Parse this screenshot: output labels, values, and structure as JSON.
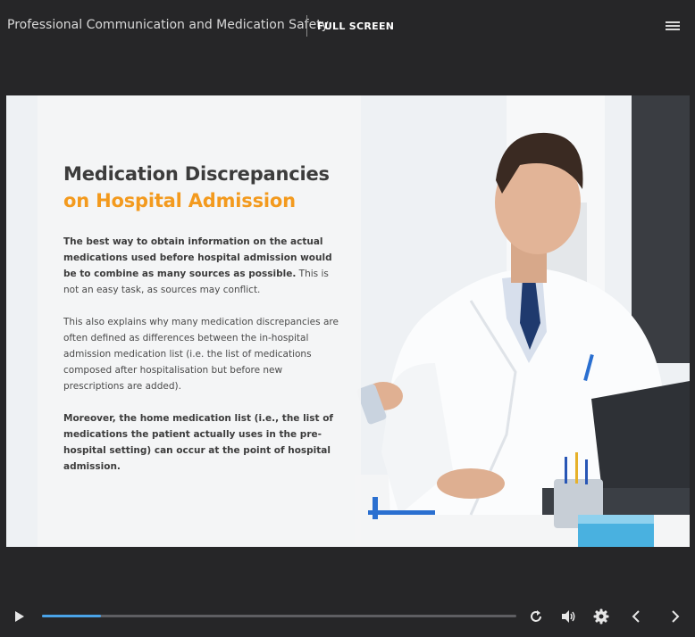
{
  "header": {
    "course_title": "Professional Communication and Medication Safety",
    "fullscreen_label": "FULL SCREEN"
  },
  "slide": {
    "heading_line1": "Medication Discrepancies",
    "heading_line2": "on Hospital Admission",
    "para1_bold": "The best way to obtain information on the actual medications used before hospital admission would be to combine as many sources as possible.",
    "para1_rest": " This is not an easy task, as sources may conflict.",
    "para2": "This also explains why many medication discrepancies are often defined as differences between the in-hospital admission medication list (i.e. the list of medications composed after hospitalisation but before new prescriptions are added).",
    "para3": "Moreover, the home medication list (i.e., the list of medications the patient actually uses in the pre-hospital setting) can occur at the point of hospital admission."
  },
  "player": {
    "progress": 0.125
  },
  "icons": {
    "menu": "hamburger-menu-icon",
    "play": "play-icon",
    "replay": "replay-icon",
    "volume": "volume-icon",
    "settings": "gear-icon",
    "prev": "chevron-left-icon",
    "next": "chevron-right-icon"
  },
  "colors": {
    "accent_orange": "#f39a1e",
    "progress_blue": "#4aa3e8",
    "background": "#262628"
  }
}
